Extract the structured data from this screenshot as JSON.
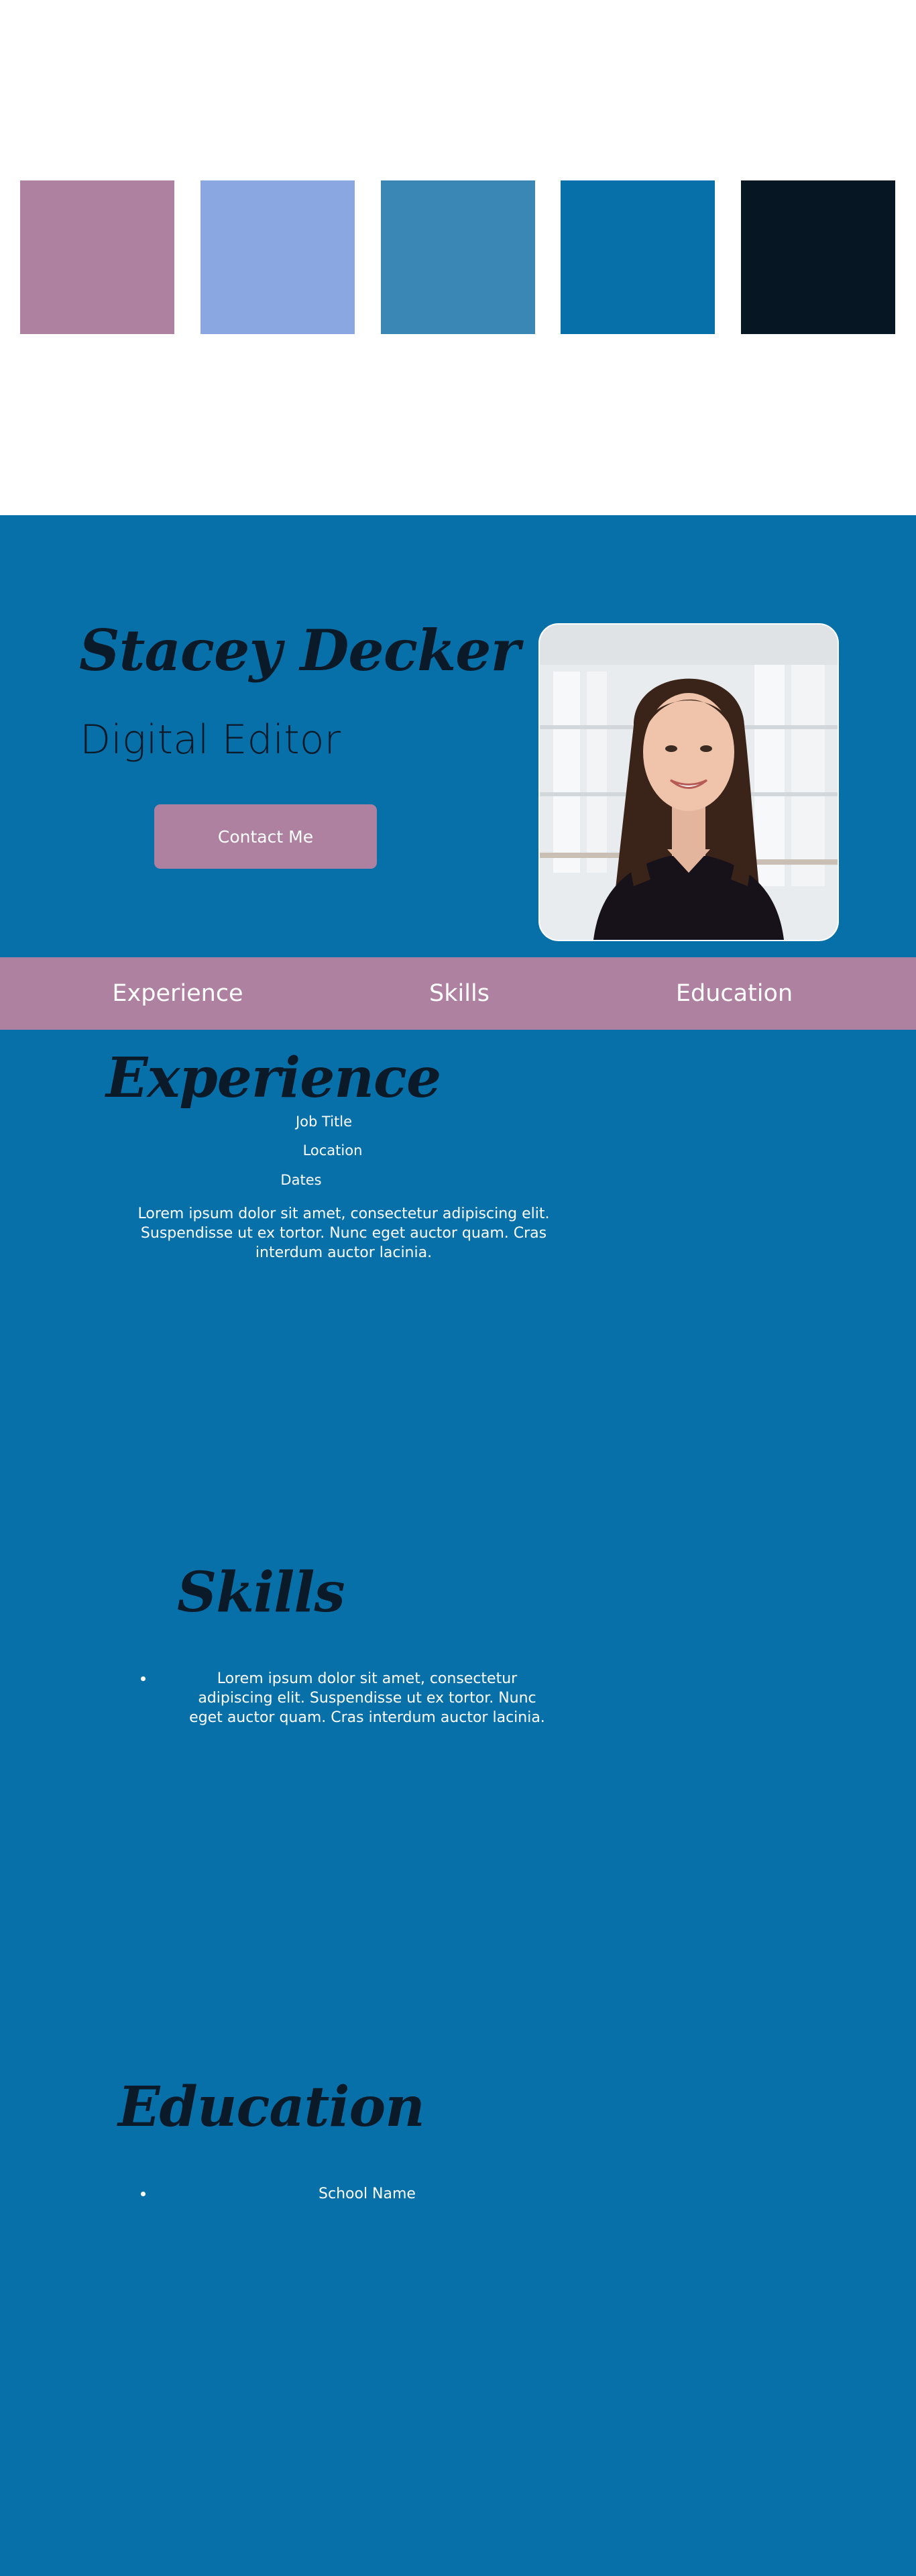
{
  "palette": {
    "colors": [
      "#ad819f",
      "#8aa7e2",
      "#3a86b5",
      "#0770a8",
      "#071623"
    ]
  },
  "hero": {
    "name": "Stacey Decker",
    "role": "Digital Editor",
    "contact_label": "Contact Me",
    "portrait_alt": "Portrait of Stacey Decker"
  },
  "nav": {
    "items": [
      {
        "label": "Experience"
      },
      {
        "label": "Skills"
      },
      {
        "label": "Education"
      }
    ]
  },
  "experience": {
    "title": "Experience",
    "job_title": "Job Title",
    "location": "Location",
    "dates": "Dates",
    "description": "Lorem ipsum dolor sit amet, consectetur adipiscing elit. Suspendisse ut ex tortor. Nunc eget auctor quam. Cras interdum auctor lacinia."
  },
  "skills": {
    "title": "Skills",
    "items": [
      "Lorem ipsum dolor sit amet, consectetur adipiscing elit. Suspendisse ut ex tortor. Nunc eget auctor quam. Cras interdum auctor lacinia."
    ]
  },
  "education": {
    "title": "Education",
    "items": [
      "School Name"
    ]
  },
  "colors": {
    "page_blue": "#0770a8",
    "accent_mauve": "#ad819f",
    "heading_navy": "#0b1a29",
    "text_white": "#ffffff"
  }
}
